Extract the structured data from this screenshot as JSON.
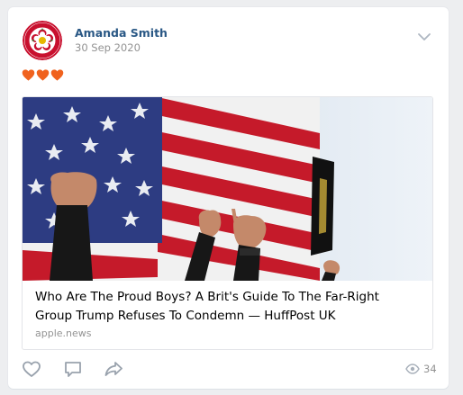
{
  "post": {
    "author": "Amanda Smith",
    "date": "30 Sep 2020",
    "emoji": [
      "orange-heart",
      "orange-heart",
      "orange-heart"
    ],
    "attachment": {
      "title": "Who Are The Proud Boys? A Brit's Guide To The Far-Right Group Trump Refuses To Condemn — HuffPost UK",
      "domain": "apple.news"
    },
    "footer": {
      "views": "34"
    }
  },
  "colors": {
    "author_link": "#2a5885",
    "muted_text": "#939393",
    "heart": "#f0621e",
    "icon": "#99a2ad"
  }
}
